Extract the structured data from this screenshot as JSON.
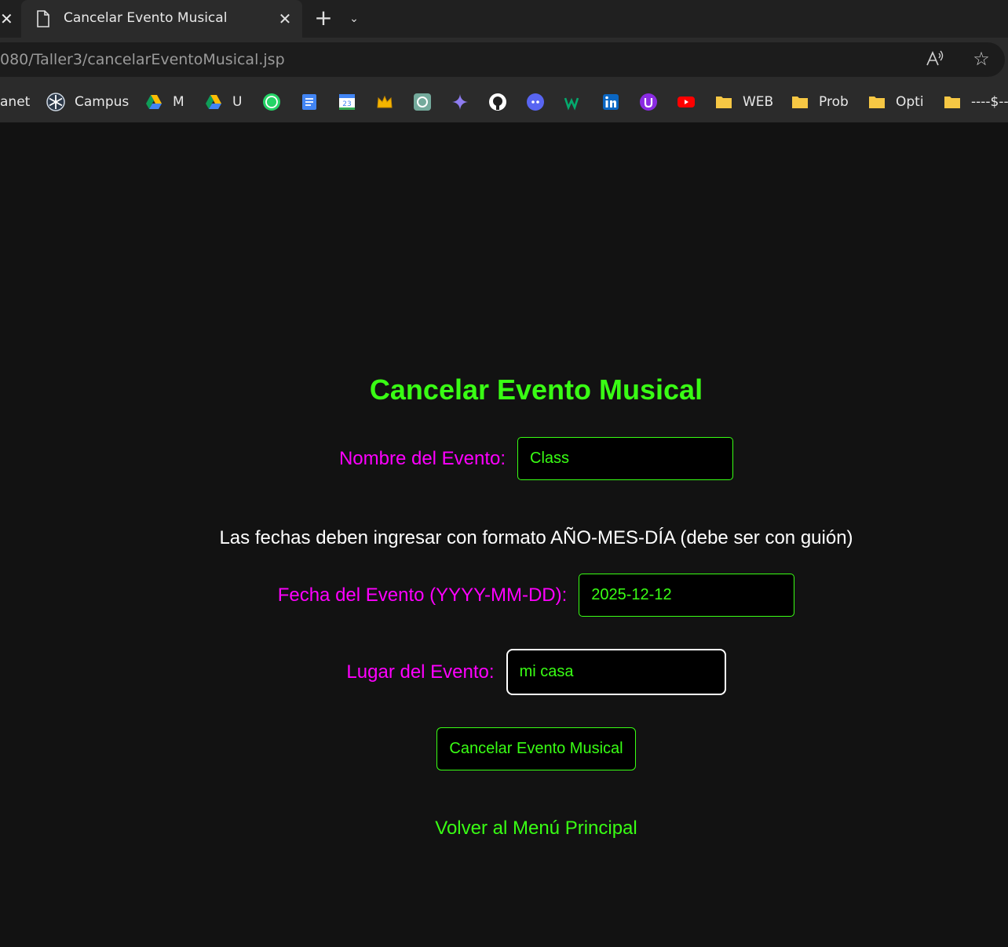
{
  "browser": {
    "tab": {
      "title": "Cancelar Evento Musical"
    },
    "address_bar": {
      "url": "080/Taller3/cancelarEventoMusical.jsp"
    },
    "bookmarks": [
      {
        "label": "anet",
        "icon": "none"
      },
      {
        "label": "Campus",
        "icon": "snowflake-icon"
      },
      {
        "label": "M",
        "icon": "google-drive-icon"
      },
      {
        "label": "U",
        "icon": "google-drive-icon"
      },
      {
        "label": "",
        "icon": "whatsapp-icon"
      },
      {
        "label": "",
        "icon": "google-docs-icon"
      },
      {
        "label": "",
        "icon": "google-calendar-icon"
      },
      {
        "label": "",
        "icon": "crown-icon"
      },
      {
        "label": "",
        "icon": "chatgpt-icon"
      },
      {
        "label": "",
        "icon": "gemini-icon"
      },
      {
        "label": "",
        "icon": "github-icon"
      },
      {
        "label": "",
        "icon": "discord-icon"
      },
      {
        "label": "",
        "icon": "w3-icon"
      },
      {
        "label": "",
        "icon": "linkedin-icon"
      },
      {
        "label": "",
        "icon": "u-purple-icon"
      },
      {
        "label": "",
        "icon": "youtube-icon"
      },
      {
        "label": "WEB",
        "icon": "folder-icon"
      },
      {
        "label": "Prob",
        "icon": "folder-icon"
      },
      {
        "label": "Opti",
        "icon": "folder-icon"
      },
      {
        "label": "----$--",
        "icon": "folder-icon"
      }
    ],
    "calendar_day": "23"
  },
  "page": {
    "title": "Cancelar Evento Musical",
    "form": {
      "nombre_label": "Nombre del Evento:",
      "nombre_value": "Class",
      "note": "Las fechas deben ingresar con formato AÑO-MES-DÍA (debe ser con guión)",
      "fecha_label": "Fecha del Evento (YYYY-MM-DD):",
      "fecha_value": "2025-12-12",
      "lugar_label": "Lugar del Evento:",
      "lugar_value": "mi casa",
      "submit_label": "Cancelar Evento Musical"
    },
    "back_link": "Volver al Menú Principal"
  },
  "colors": {
    "accent_green": "#39ff14",
    "label_magenta": "#ff00ff",
    "background": "#121212"
  }
}
